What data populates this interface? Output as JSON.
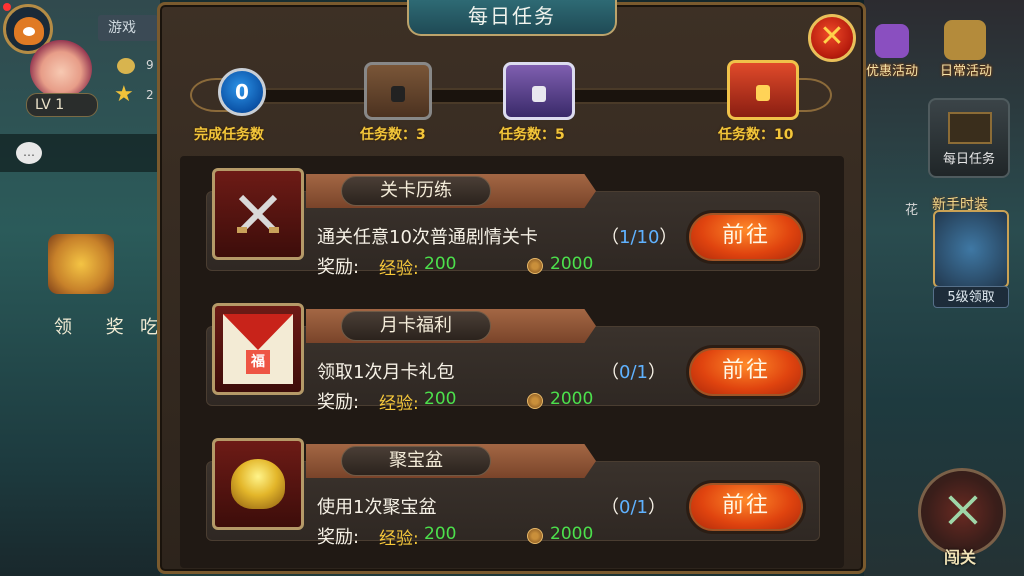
{
  "hud": {
    "player_level": "LV  1",
    "top_tab": "游戏",
    "coins_partial": "9",
    "stars_partial": "2",
    "claim_reward": "领 奖",
    "eat_partial": "吃"
  },
  "right_menu": {
    "promo_event": "优惠活动",
    "daily_event": "日常活动",
    "daily_tasks": "每日任务",
    "newbie_outfit": "新手时装",
    "newbie_level": "5级领取",
    "flower_partial": "花",
    "battle": "闯关"
  },
  "panel": {
    "title": "每日任务",
    "close": "✕"
  },
  "progress": {
    "completed_count": "0",
    "completed_label": "完成任务数",
    "milestones": [
      {
        "label": "任务数：3",
        "chest": "wood"
      },
      {
        "label": "任务数：5",
        "chest": "silver"
      },
      {
        "label": "任务数：10",
        "chest": "gold"
      }
    ]
  },
  "tasks": [
    {
      "name": "关卡历练",
      "icon": "crossed-swords-icon",
      "description": "通关任意10次普通剧情关卡",
      "progress": "1/10",
      "reward_label": "奖励:",
      "exp_label": "经验:",
      "exp_value": "200",
      "coin_value": "2000",
      "button": "前往"
    },
    {
      "name": "月卡福利",
      "icon": "red-envelope-icon",
      "description": "领取1次月卡礼包",
      "progress": "0/1",
      "reward_label": "奖励:",
      "exp_label": "经验:",
      "exp_value": "200",
      "coin_value": "2000",
      "button": "前往"
    },
    {
      "name": "聚宝盆",
      "icon": "treasure-bowl-icon",
      "description": "使用1次聚宝盆",
      "progress": "0/1",
      "reward_label": "奖励:",
      "exp_label": "经验:",
      "exp_value": "200",
      "coin_value": "2000",
      "button": "前往"
    }
  ],
  "colors": {
    "accent_gold": "#f3c63a",
    "exp_green": "#4ce04c",
    "progress_blue": "#5fb2ff",
    "go_button": "#e0440f"
  }
}
